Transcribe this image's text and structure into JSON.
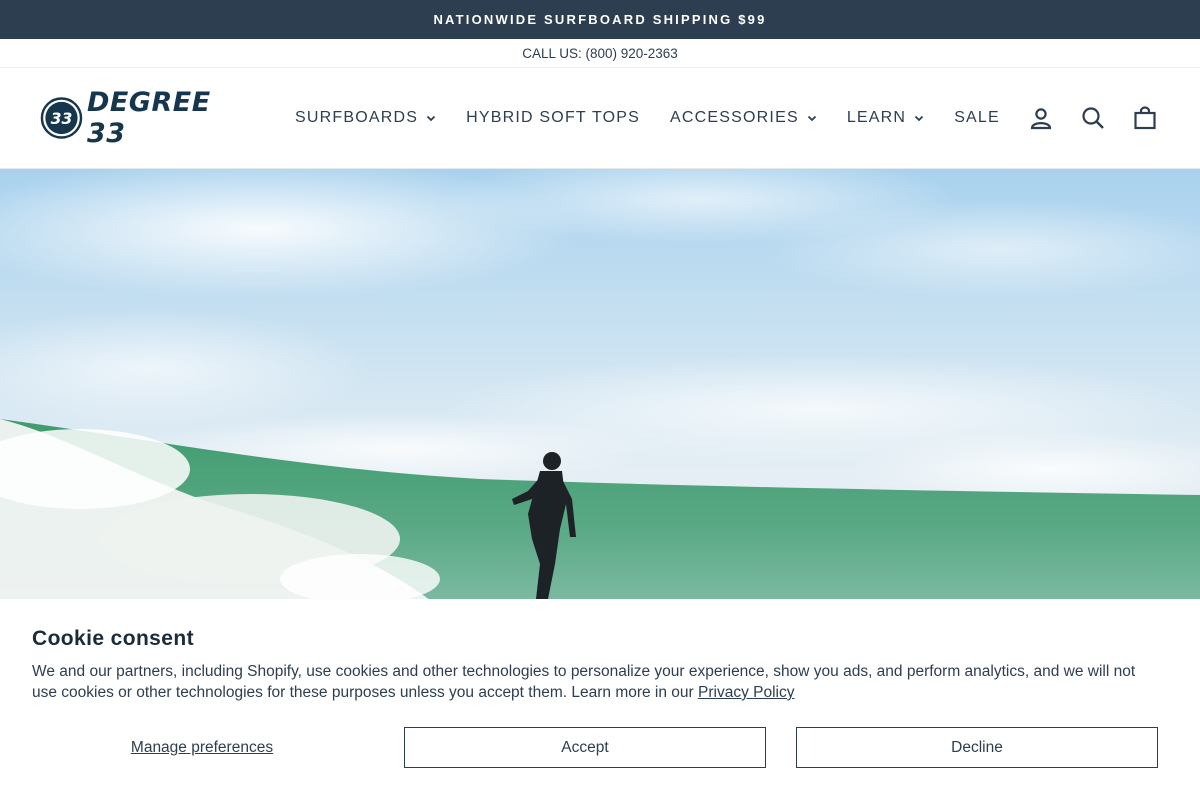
{
  "announcement": {
    "text": "NATIONWIDE SURFBOARD SHIPPING $99"
  },
  "callbar": {
    "text": "CALL US: (800) 920-2363"
  },
  "header": {
    "logo_text": "DEGREE 33",
    "logo_badge": "33",
    "nav": [
      {
        "label": "SURFBOARDS",
        "dropdown": true
      },
      {
        "label": "HYBRID SOFT TOPS",
        "dropdown": false
      },
      {
        "label": "ACCESSORIES",
        "dropdown": true
      },
      {
        "label": "LEARN",
        "dropdown": true
      },
      {
        "label": "SALE",
        "dropdown": false
      }
    ],
    "icons": [
      "account-icon",
      "search-icon",
      "cart-icon"
    ]
  },
  "colors": {
    "announcement_bg": "#2d3e50",
    "brand_navy": "#16364d",
    "text": "#2d3e50"
  },
  "cookie": {
    "title": "Cookie consent",
    "body": "We and our partners, including Shopify, use cookies and other technologies to personalize your experience, show you ads, and perform analytics, and we will not use cookies or other technologies for these purposes unless you accept them. Learn more in our ",
    "policy_link": "Privacy Policy",
    "manage_label": "Manage preferences",
    "accept_label": "Accept",
    "decline_label": "Decline"
  }
}
